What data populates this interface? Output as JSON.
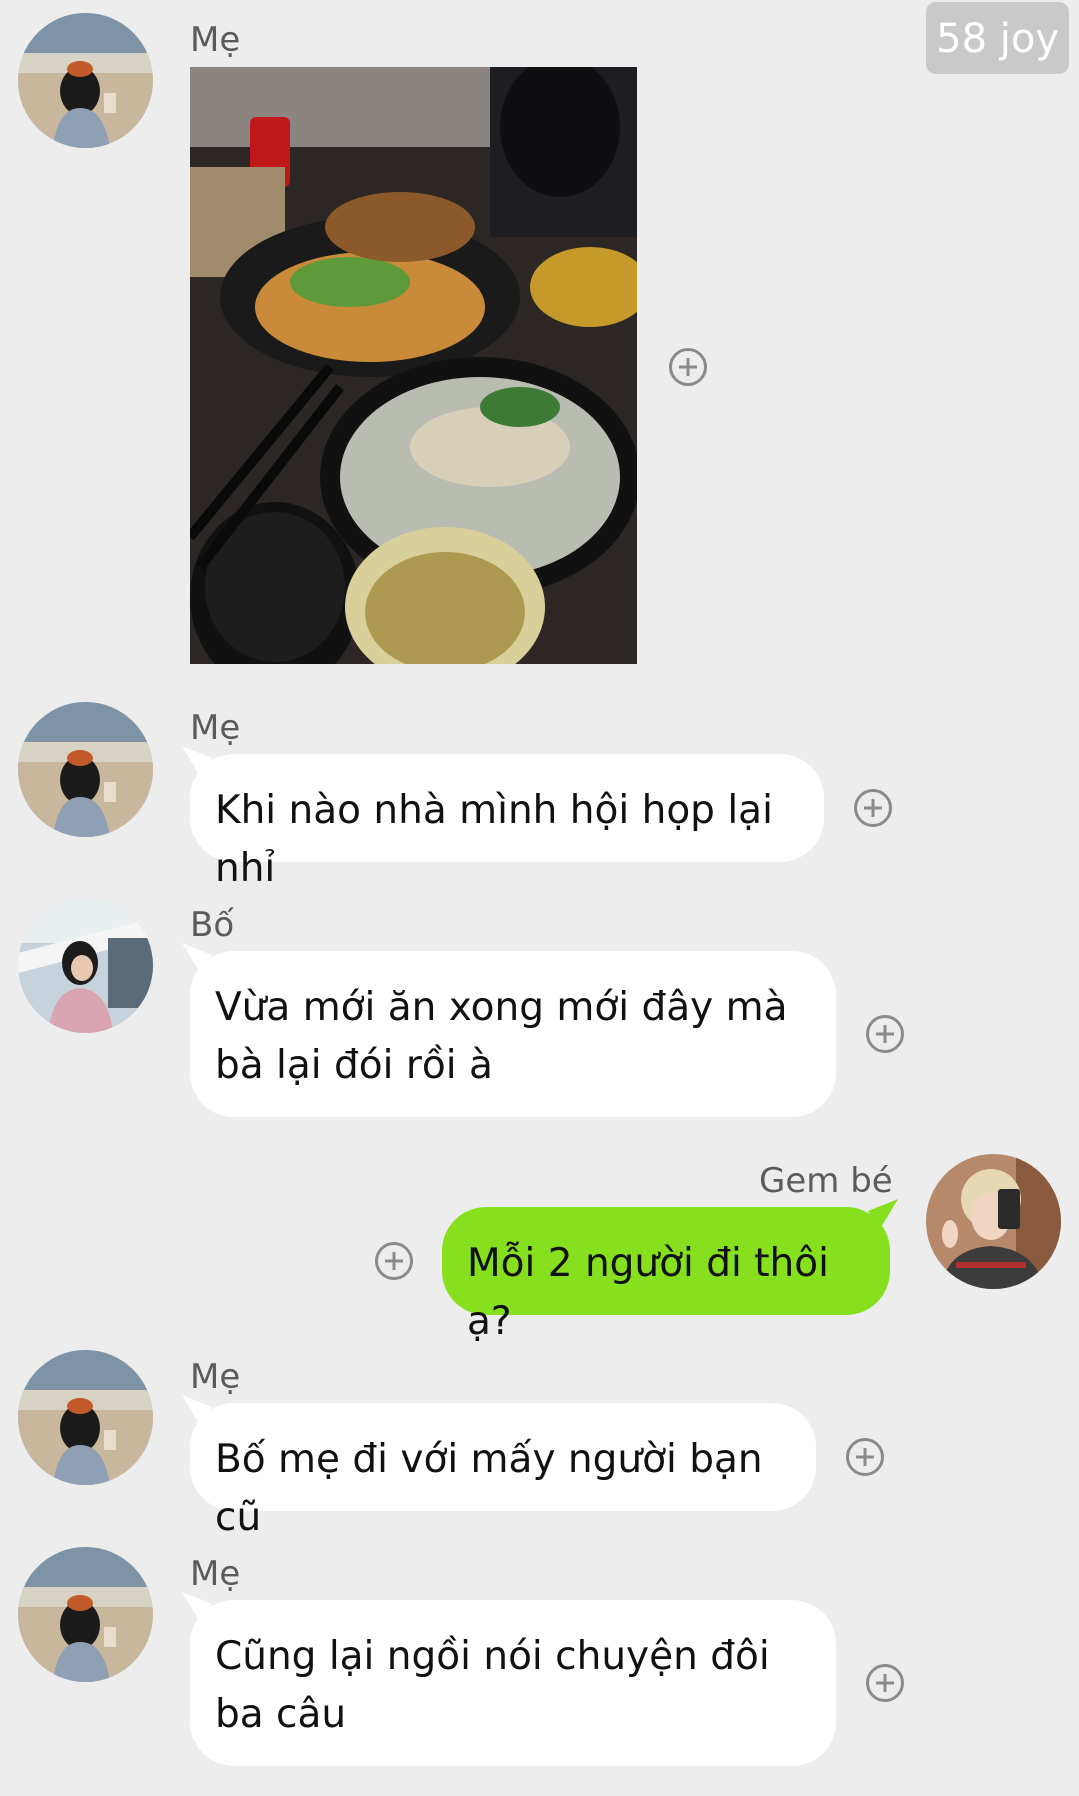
{
  "watermark": "58 joy",
  "messages": [
    {
      "sender": "Mẹ",
      "type": "image",
      "image_icon": "food-photo"
    },
    {
      "sender": "Mẹ",
      "type": "text",
      "text": "Khi nào nhà mình hội họp lại nhỉ"
    },
    {
      "sender": "Bố",
      "type": "text",
      "text": "Vừa mới ăn xong mới đây mà bà lại đói rồi à"
    },
    {
      "sender": "Gem bé",
      "type": "text",
      "text": "Mỗi 2 người đi thôi ạ?",
      "self": true
    },
    {
      "sender": "Mẹ",
      "type": "text",
      "text": "Bố mẹ đi với mấy người bạn cũ"
    },
    {
      "sender": "Mẹ",
      "type": "text",
      "text": "Cũng lại ngồi nói chuyện đôi ba câu"
    }
  ],
  "colors": {
    "background": "#ededed",
    "bubble_other": "#ffffff",
    "bubble_self": "#86e01e",
    "name": "#5b5b5b"
  }
}
